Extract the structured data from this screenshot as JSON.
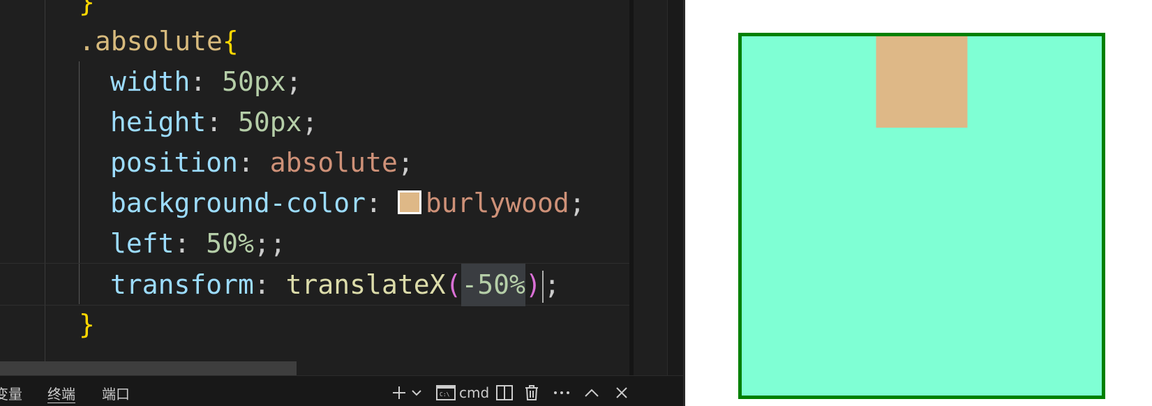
{
  "editor": {
    "lines": [
      {
        "tokens": [
          {
            "t": "}",
            "c": "tok-brace"
          }
        ]
      },
      {
        "tokens": [
          {
            "t": ".absolute",
            "c": "tok-sel"
          },
          {
            "t": "{",
            "c": "tok-brace"
          }
        ]
      },
      {
        "tokens": [
          {
            "t": "width",
            "c": "tok-prop"
          },
          {
            "t": ": ",
            "c": "tok-punc"
          },
          {
            "t": "50px",
            "c": "tok-num"
          },
          {
            "t": ";",
            "c": "tok-punc"
          }
        ]
      },
      {
        "tokens": [
          {
            "t": "height",
            "c": "tok-prop"
          },
          {
            "t": ": ",
            "c": "tok-punc"
          },
          {
            "t": "50px",
            "c": "tok-num"
          },
          {
            "t": ";",
            "c": "tok-punc"
          }
        ]
      },
      {
        "tokens": [
          {
            "t": "position",
            "c": "tok-prop"
          },
          {
            "t": ": ",
            "c": "tok-punc"
          },
          {
            "t": "absolute",
            "c": "tok-str"
          },
          {
            "t": ";",
            "c": "tok-punc"
          }
        ]
      },
      {
        "tokens": [
          {
            "t": "background-color",
            "c": "tok-prop"
          },
          {
            "t": ": ",
            "c": "tok-punc"
          },
          {
            "swatch": "#deb887"
          },
          {
            "t": "burlywood",
            "c": "tok-str"
          },
          {
            "t": ";",
            "c": "tok-punc"
          }
        ]
      },
      {
        "tokens": [
          {
            "t": "left",
            "c": "tok-prop"
          },
          {
            "t": ": ",
            "c": "tok-punc"
          },
          {
            "t": "50%",
            "c": "tok-num"
          },
          {
            "t": ";;",
            "c": "tok-punc"
          }
        ]
      },
      {
        "tokens": [
          {
            "t": "transform",
            "c": "tok-prop"
          },
          {
            "t": ": ",
            "c": "tok-punc"
          },
          {
            "t": "translateX",
            "c": "tok-fn"
          },
          {
            "t": "(",
            "c": "tok-paren"
          },
          {
            "t": "-50%",
            "c": "tok-num tok-hl"
          },
          {
            "t": ")",
            "c": "tok-paren"
          },
          {
            "cursor": true
          },
          {
            "t": ";",
            "c": "tok-punc"
          }
        ],
        "active": true
      },
      {
        "tokens": [
          {
            "t": "}",
            "c": "tok-brace"
          }
        ]
      }
    ]
  },
  "panel": {
    "tabs": [
      "变量",
      "终端",
      "端口"
    ],
    "terminal_name": "cmd",
    "icons": [
      "add-terminal-icon",
      "chevron-down-icon",
      "cmd-terminal-icon",
      "split-terminal-icon",
      "trash-icon",
      "more-icon",
      "maximize-panel-icon",
      "close-icon"
    ]
  },
  "preview": {
    "container_border_color": "#008000",
    "container_background_color": "#7fffd4",
    "box_background_color": "#deb887"
  }
}
